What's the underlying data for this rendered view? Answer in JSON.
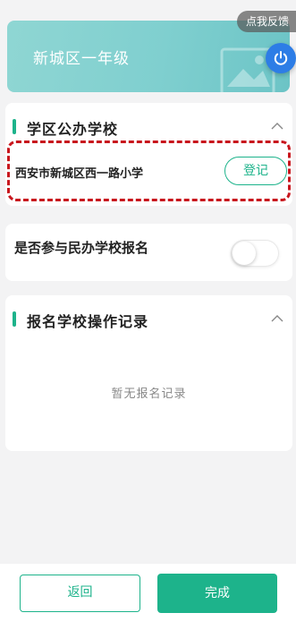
{
  "banner": {
    "title": "新城区一年级"
  },
  "feedback": {
    "label": "点我反馈"
  },
  "public_school": {
    "title": "学区公办学校",
    "school_name": "西安市新城区西一路小学",
    "register_label": "登记"
  },
  "private_school": {
    "label": "是否参与民办学校报名",
    "enabled": false
  },
  "records": {
    "title": "报名学校操作记录",
    "empty_text": "暂无报名记录"
  },
  "footer": {
    "back_label": "返回",
    "done_label": "完成"
  },
  "colors": {
    "accent": "#1db38b",
    "highlight_dash": "#c8161d",
    "power_button": "#2d7de6"
  },
  "icons": [
    "power-icon",
    "chevron-up-icon"
  ]
}
